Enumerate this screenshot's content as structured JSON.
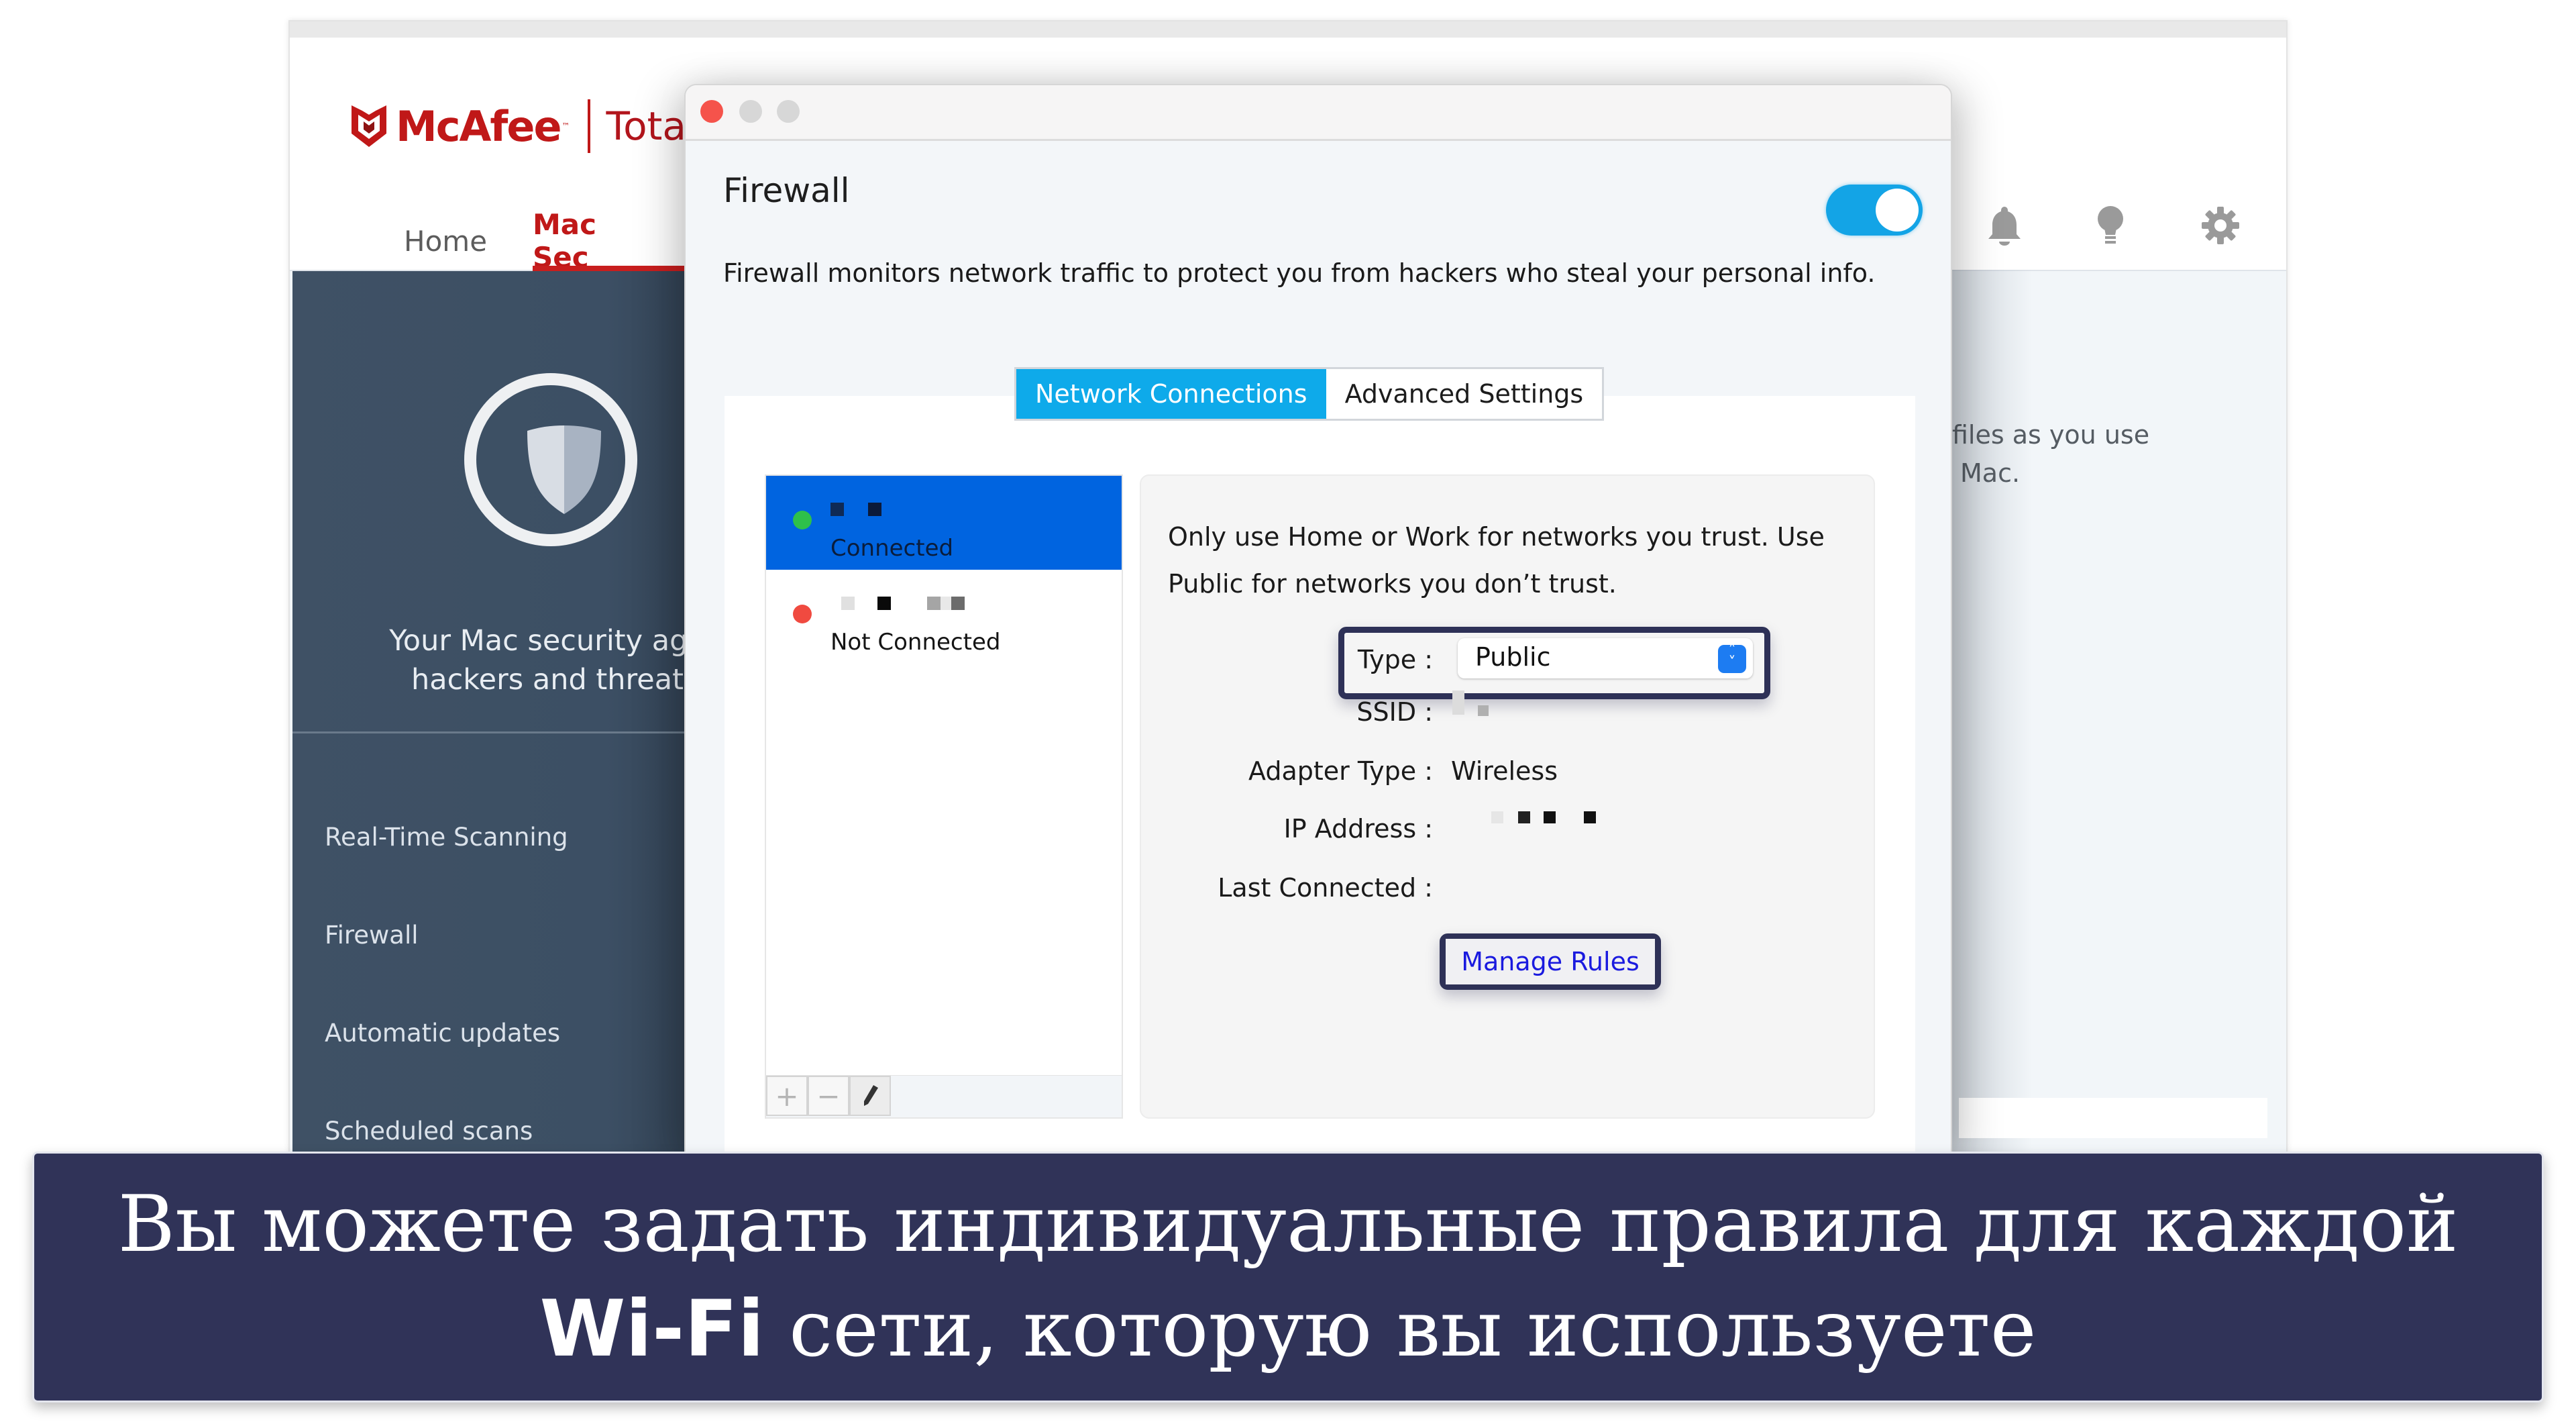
{
  "app": {
    "brand": "McAfee",
    "brand_tm": "™",
    "product": "Total",
    "nav": [
      {
        "label": "Home",
        "active": false
      },
      {
        "label": "Mac Sec",
        "active": true
      }
    ],
    "header_icons": [
      "bell-icon",
      "lightbulb-icon",
      "gear-icon"
    ],
    "accent_color": "#c01818"
  },
  "sidebar": {
    "status_message_line1": "Your Mac security aga",
    "status_message_line2": "hackers and threat",
    "items": [
      {
        "label": "Real-Time Scanning"
      },
      {
        "label": "Firewall"
      },
      {
        "label": "Automatic updates"
      },
      {
        "label": "Scheduled scans"
      }
    ]
  },
  "background_panel": {
    "text_line1": "files as you use",
    "text_line2": "Mac."
  },
  "dialog": {
    "title": "Firewall",
    "toggle_on": true,
    "description": "Firewall monitors network traffic to protect you from hackers who steal your personal info.",
    "tabs": [
      {
        "label": "Network Connections",
        "active": true
      },
      {
        "label": "Advanced Settings",
        "active": false
      }
    ],
    "networks": [
      {
        "status": "Connected",
        "status_color": "#2ec04a",
        "selected": true
      },
      {
        "status": "Not Connected",
        "status_color": "#f04a40",
        "selected": false
      }
    ],
    "list_toolbar": {
      "add": "+",
      "remove": "−",
      "edit": "pencil-icon"
    },
    "details": {
      "hint": "Only use Home or Work for networks you trust. Use Public for networks you don’t trust.",
      "type_label": "Type :",
      "type_value": "Public",
      "ssid_label": "SSID :",
      "adapter_label": "Adapter Type :",
      "adapter_value": "Wireless",
      "ip_label": "IP Address :",
      "last_connected_label": "Last Connected :",
      "manage_rules": "Manage Rules"
    }
  },
  "caption": {
    "line1": "Вы можете задать индивидуальные правила для каждой",
    "line2_wifi": "Wi-Fi",
    "line2_rest": " сети, которую вы используете"
  }
}
